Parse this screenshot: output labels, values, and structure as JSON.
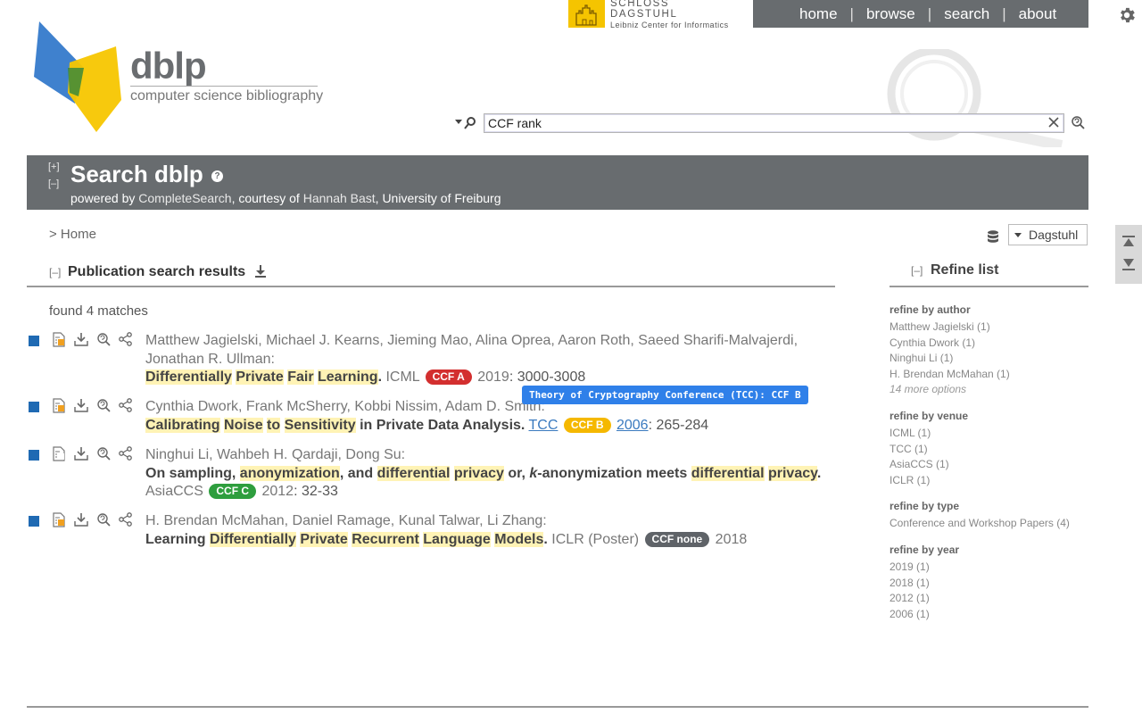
{
  "header": {
    "dagstuhl_title": "SCHLOSS DAGSTUHL",
    "dagstuhl_sub": "Leibniz Center for Informatics",
    "nav": [
      {
        "label": "home"
      },
      {
        "label": "browse"
      },
      {
        "label": "search"
      },
      {
        "label": "about"
      }
    ],
    "nav_separator": "|"
  },
  "logo": {
    "title": "dblp",
    "subtitle": "computer science bibliography"
  },
  "search": {
    "value": "CCF rank"
  },
  "banner": {
    "expand": "[+]",
    "collapse": "[–]",
    "title": "Search dblp",
    "help": "?",
    "powered_prefix": "powered by ",
    "engine": "CompleteSearch",
    "courtesy": ", courtesy of ",
    "person": "Hannah Bast",
    "affiliation": ", University of Freiburg"
  },
  "breadcrumb": "> Home",
  "mirror": "Dagstuhl",
  "results": {
    "toggle": "[–]",
    "title": "Publication search results",
    "found": "found 4 matches"
  },
  "tooltip": "Theory of Cryptography Conference (TCC): CCF B",
  "entries": [
    {
      "authors": "Matthew Jagielski, Michael J. Kearns, Jieming Mao, Alina Oprea, Aaron Roth, Saeed Sharifi-Malvajerdi, Jonathan R. Ullman:",
      "title_parts": [
        {
          "t": "Differentially",
          "hl": true
        },
        {
          "t": " ",
          "hl": false
        },
        {
          "t": "Private",
          "hl": true
        },
        {
          "t": " ",
          "hl": false
        },
        {
          "t": "Fair",
          "hl": true
        },
        {
          "t": " ",
          "hl": false
        },
        {
          "t": "Learning",
          "hl": true
        },
        {
          "t": ".",
          "hl": false
        }
      ],
      "venue": "ICML",
      "badge": "CCF A",
      "badge_color": "#d32f2f",
      "year": "2019",
      "pages": ": 3000-3008"
    },
    {
      "authors": "Cynthia Dwork, Frank McSherry, Kobbi Nissim, Adam D. Smith:",
      "title_parts": [
        {
          "t": "Calibrating",
          "hl": true
        },
        {
          "t": " ",
          "hl": false
        },
        {
          "t": "Noise",
          "hl": true
        },
        {
          "t": " ",
          "hl": false
        },
        {
          "t": "to",
          "hl": true
        },
        {
          "t": " ",
          "hl": false
        },
        {
          "t": "Sensitivity",
          "hl": true
        },
        {
          "t": " in Private Data Analysis.",
          "hl": false
        }
      ],
      "venue": "TCC",
      "badge": "CCF B",
      "badge_color": "#f5b800",
      "year": "2006",
      "pages": ": 265-284"
    },
    {
      "authors": "Ninghui Li, Wahbeh H. Qardaji, Dong Su:",
      "title_parts": [
        {
          "t": "On sampling, ",
          "hl": false
        },
        {
          "t": "anonymization",
          "hl": true
        },
        {
          "t": ", and ",
          "hl": false
        },
        {
          "t": "differential",
          "hl": true
        },
        {
          "t": " ",
          "hl": false
        },
        {
          "t": "privacy",
          "hl": true
        },
        {
          "t": " or, ",
          "hl": false
        },
        {
          "t": "k",
          "hl": false,
          "it": true
        },
        {
          "t": "-anonymization meets ",
          "hl": false
        },
        {
          "t": "differential",
          "hl": true
        },
        {
          "t": " ",
          "hl": false
        },
        {
          "t": "privacy",
          "hl": true
        },
        {
          "t": ".",
          "hl": false
        }
      ],
      "venue": "AsiaCCS",
      "badge": "CCF C",
      "badge_color": "#2e9e3e",
      "year": "2012",
      "pages": ": 32-33"
    },
    {
      "authors": "H. Brendan McMahan, Daniel Ramage, Kunal Talwar, Li Zhang:",
      "title_parts": [
        {
          "t": "Learning ",
          "hl": false
        },
        {
          "t": "Differentially",
          "hl": true
        },
        {
          "t": " ",
          "hl": false
        },
        {
          "t": "Private",
          "hl": true
        },
        {
          "t": " ",
          "hl": false
        },
        {
          "t": "Recurrent",
          "hl": true
        },
        {
          "t": " ",
          "hl": false
        },
        {
          "t": "Language",
          "hl": true
        },
        {
          "t": " ",
          "hl": false
        },
        {
          "t": "Models",
          "hl": true
        },
        {
          "t": ".",
          "hl": false
        }
      ],
      "venue": "ICLR (Poster)",
      "badge": "CCF none",
      "badge_color": "#5f6368",
      "year": "2018",
      "pages": ""
    }
  ],
  "refine": {
    "toggle": "[–]",
    "title": "Refine list",
    "groups": [
      {
        "heading": "refine by author",
        "items": [
          "Matthew Jagielski (1)",
          "Cynthia Dwork (1)",
          "Ninghui Li (1)",
          "H. Brendan McMahan (1)"
        ],
        "more": "14 more options"
      },
      {
        "heading": "refine by venue",
        "items": [
          "ICML (1)",
          "TCC (1)",
          "AsiaCCS (1)",
          "ICLR (1)"
        ],
        "more": ""
      },
      {
        "heading": "refine by type",
        "items": [
          "Conference and Workshop Papers (4)"
        ],
        "more": ""
      },
      {
        "heading": "refine by year",
        "items": [
          "2019 (1)",
          "2018 (1)",
          "2012 (1)",
          "2006 (1)"
        ],
        "more": ""
      }
    ]
  }
}
